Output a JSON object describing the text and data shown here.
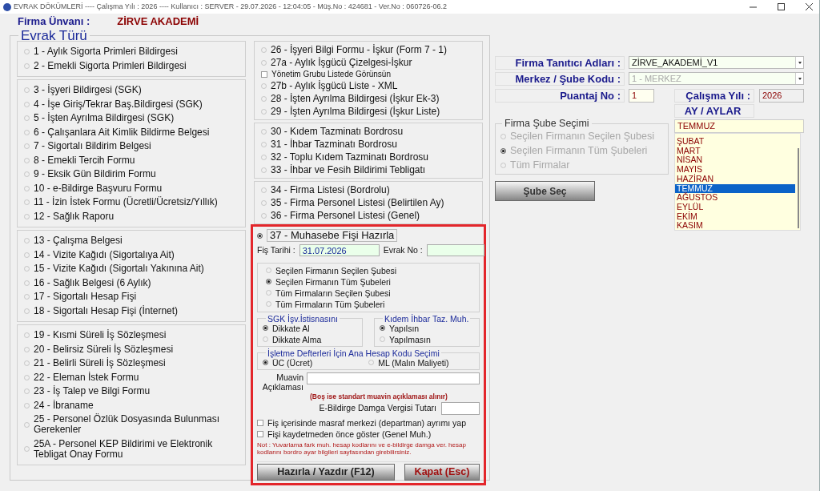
{
  "window": {
    "title": "EVRAK DÖKÜMLERİ ---- Çalışma Yılı : 2026 ---- Kullanıcı : SERVER - 29.07.2026 - 12:04:05 - Müş.No : 424681 - Ver.No : 060726-06.2"
  },
  "company": {
    "label": "Firma Ünvanı :",
    "value": "ZİRVE AKADEMİ"
  },
  "document_types": {
    "title": "Evrak Türü",
    "columns": [
      {
        "groups": [
          {
            "items": [
              {
                "kind": "radio",
                "label": "1 - Aylık Sigorta Primleri Bildirgesi",
                "selected": false
              },
              {
                "kind": "radio",
                "label": "2 - Emekli Sigorta Primleri Bildirgesi",
                "selected": false
              }
            ]
          },
          {
            "items": [
              {
                "kind": "radio",
                "label": "3 - İşyeri Bildirgesi (SGK)",
                "selected": false
              },
              {
                "kind": "radio",
                "label": "4 - İşe Giriş/Tekrar Baş.Bildirgesi (SGK)",
                "selected": false
              },
              {
                "kind": "radio",
                "label": "5 - İşten Ayrılma Bildirgesi (SGK)",
                "selected": false
              },
              {
                "kind": "radio",
                "label": "6 - Çalışanlara Ait Kimlik Bildirme Belgesi",
                "selected": false
              },
              {
                "kind": "radio",
                "label": "7 - Sigortalı Bildirim Belgesi",
                "selected": false
              },
              {
                "kind": "radio",
                "label": "8 - Emekli Tercih Formu",
                "selected": false
              },
              {
                "kind": "radio",
                "label": "9 - Eksik Gün Bildirim Formu",
                "selected": false
              },
              {
                "kind": "radio",
                "label": "10 - e-Bildirge Başvuru Formu",
                "selected": false
              },
              {
                "kind": "radio",
                "label": "11 - İzin İstek Formu (Ücretli/Ücretsiz/Yıllık)",
                "selected": false
              },
              {
                "kind": "radio",
                "label": "12 - Sağlık Raporu",
                "selected": false
              }
            ]
          },
          {
            "items": [
              {
                "kind": "radio",
                "label": "13 - Çalışma Belgesi",
                "selected": false
              },
              {
                "kind": "radio",
                "label": "14 - Vizite Kağıdı (Sigortalıya Ait)",
                "selected": false
              },
              {
                "kind": "radio",
                "label": "15 - Vizite Kağıdı (Sigortalı Yakınına Ait)",
                "selected": false
              },
              {
                "kind": "radio",
                "label": "16 - Sağlık Belgesi (6 Aylık)",
                "selected": false
              },
              {
                "kind": "radio",
                "label": "17 - Sigortalı Hesap Fişi",
                "selected": false
              },
              {
                "kind": "radio",
                "label": "18 - Sigortalı Hesap Fişi (İnternet)",
                "selected": false
              }
            ]
          },
          {
            "items": [
              {
                "kind": "radio",
                "label": "19 - Kısmi Süreli İş Sözleşmesi",
                "selected": false
              },
              {
                "kind": "radio",
                "label": "20 - Belirsiz Süreli İş Sözleşmesi",
                "selected": false
              },
              {
                "kind": "radio",
                "label": "21 - Belirli Süreli İş Sözleşmesi",
                "selected": false
              },
              {
                "kind": "radio",
                "label": "22 - Eleman İstek Formu",
                "selected": false
              },
              {
                "kind": "radio",
                "label": "23 - İş Talep ve Bilgi Formu",
                "selected": false
              },
              {
                "kind": "radio",
                "label": "24 - İbraname",
                "selected": false
              },
              {
                "kind": "radio",
                "label": "25 - Personel Özlük Dosyasında Bulunması Gerekenler",
                "selected": false
              },
              {
                "kind": "radio",
                "label": "25A - Personel KEP Bildirimi ve Elektronik Tebligat Onay Formu",
                "selected": false
              }
            ]
          }
        ]
      },
      {
        "groups": [
          {
            "items": [
              {
                "kind": "radio",
                "label": "26 - İşyeri Bilgi Formu - İşkur (Form 7 - 1)",
                "selected": false
              },
              {
                "kind": "radio",
                "label": "27a - Aylık İşgücü Çizelgesi-İşkur",
                "selected": false
              },
              {
                "kind": "checkbox",
                "label": "Yönetim Grubu Listede Görünsün",
                "checked": false
              },
              {
                "kind": "radio",
                "label": "27b - Aylık İşgücü Liste - XML",
                "selected": false
              },
              {
                "kind": "radio",
                "label": "28 - İşten Ayrılma Bildirgesi (İşkur Ek-3)",
                "selected": false
              },
              {
                "kind": "radio",
                "label": "29 - İşten Ayrılma Bildirgesi (İşkur Liste)",
                "selected": false
              }
            ]
          },
          {
            "items": [
              {
                "kind": "radio",
                "label": "30 - Kıdem Tazminatı Bordrosu",
                "selected": false
              },
              {
                "kind": "radio",
                "label": "31 - İhbar Tazminatı Bordrosu",
                "selected": false
              },
              {
                "kind": "radio",
                "label": "32 - Toplu Kıdem Tazminatı Bordrosu",
                "selected": false
              },
              {
                "kind": "radio",
                "label": "33 - İhbar ve Fesih Bildirimi Tebligatı",
                "selected": false
              }
            ]
          },
          {
            "items": [
              {
                "kind": "radio",
                "label": "34 - Firma Listesi (Bordrolu)",
                "selected": false
              },
              {
                "kind": "radio",
                "label": "35 - Firma Personel Listesi (Belirtilen Ay)",
                "selected": false
              },
              {
                "kind": "radio",
                "label": "36 - Firma Personel Listesi (Genel)",
                "selected": false
              }
            ]
          }
        ]
      }
    ]
  },
  "accounting_slip": {
    "option": {
      "label": "37 - Muhasebe Fişi Hazırla",
      "selected": true
    },
    "date_label": "Fiş Tarihi :",
    "date_value": "31.07.2026",
    "doc_no_label": "Evrak No :",
    "scope_options": [
      {
        "label": "Seçilen Firmanın Seçilen Şubesi",
        "selected": false
      },
      {
        "label": "Seçilen Firmanın Tüm Şubeleri",
        "selected": true
      },
      {
        "label": "Tüm Firmaların Seçilen Şubesi",
        "selected": false
      },
      {
        "label": "Tüm Firmaların Tüm Şubeleri",
        "selected": false
      }
    ],
    "sgk_group": {
      "title": "SGK İşv.İstisnasını",
      "options": [
        {
          "label": "Dikkate Al",
          "selected": true
        },
        {
          "label": "Dikkate Alma",
          "selected": false
        }
      ]
    },
    "severance_group": {
      "title": "Kıdem İhbar Taz. Muh.",
      "options": [
        {
          "label": "Yapılsın",
          "selected": true
        },
        {
          "label": "Yapılmasın",
          "selected": false
        }
      ]
    },
    "ledger_group": {
      "title": "İşletme Defterleri İçin Ana Hesap Kodu Seçimi",
      "options": [
        {
          "label": "ÜC (Ücret)",
          "selected": true
        },
        {
          "label": "ML (Malın Maliyeti)",
          "selected": false
        }
      ]
    },
    "sub_note_label": "Muavin Açıklaması",
    "sub_note_hint": "(Boş ise standart muavin açıklaması alınır)",
    "stamp_label": "E-Bildirge Damga Vergisi Tutarı",
    "checkboxes": [
      {
        "label": "Fiş içerisinde masraf merkezi (departman) ayrımı yap",
        "checked": false
      },
      {
        "label": "Fişi kaydetmeden önce göster (Genel Muh.)",
        "checked": false
      }
    ],
    "note": "Not : Yuvarlama fark muh. hesap kodlarını ve e-bildirge damga ver. hesap kodlarını bordro ayar bilgileri sayfasından girebilirsiniz.",
    "buttons": [
      {
        "label": "Hazırla / Yazdır (F12)",
        "kind": "primary"
      },
      {
        "label": "Kapat (Esc)",
        "kind": "close"
      }
    ]
  },
  "identity": {
    "fields": [
      {
        "label": "Firma Tanıtıcı Adları :",
        "value": "ZİRVE_AKADEMİ_V1",
        "disabled": false
      },
      {
        "label": "Merkez / Şube Kodu :",
        "value": "1 - MERKEZ",
        "disabled": true
      }
    ],
    "payroll": {
      "label": "Puantaj No :",
      "value": "1"
    },
    "year": {
      "label": "Çalışma Yılı :",
      "value": "2026"
    }
  },
  "branch_selection": {
    "title": "Firma Şube Seçimi",
    "disabled": true,
    "options": [
      {
        "label": "Seçilen Firmanın Seçilen Şubesi",
        "selected": false
      },
      {
        "label": "Seçilen Firmanın Tüm Şubeleri",
        "selected": true
      },
      {
        "label": "Tüm Firmalar",
        "selected": false
      }
    ]
  },
  "branch_button": "Şube Seç",
  "months": {
    "title": "AY / AYLAR",
    "value": "TEMMUZ",
    "items": [
      {
        "label": "ŞUBAT",
        "selected": false
      },
      {
        "label": "MART",
        "selected": false
      },
      {
        "label": "NİSAN",
        "selected": false
      },
      {
        "label": "MAYIS",
        "selected": false
      },
      {
        "label": "HAZİRAN",
        "selected": false
      },
      {
        "label": "TEMMUZ",
        "selected": true
      },
      {
        "label": "AĞUSTOS",
        "selected": false
      },
      {
        "label": "EYLÜL",
        "selected": false
      },
      {
        "label": "EKİM",
        "selected": false
      },
      {
        "label": "KASIM",
        "selected": false
      }
    ]
  }
}
